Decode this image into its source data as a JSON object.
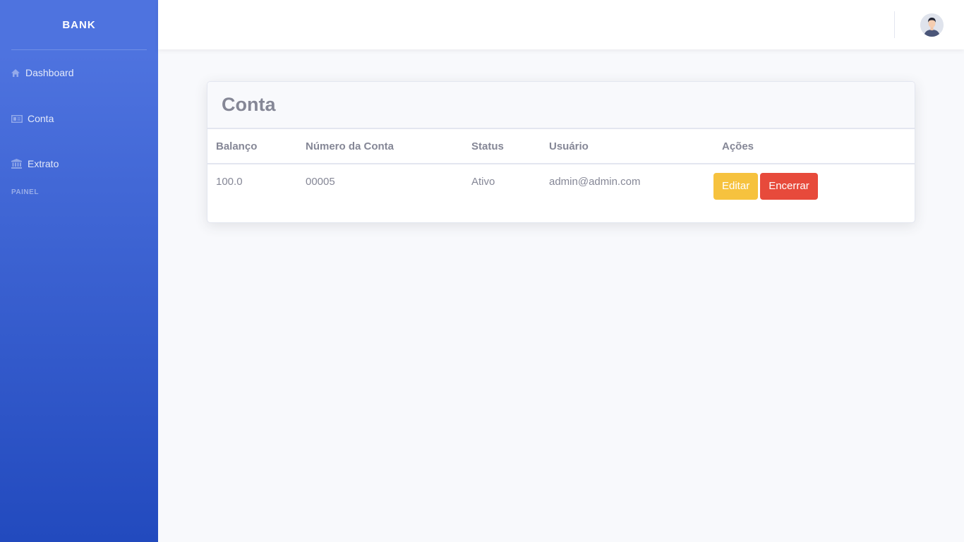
{
  "sidebar": {
    "brand": "BANK",
    "items": [
      {
        "label": "Dashboard",
        "icon": "home-icon"
      },
      {
        "label": "Conta",
        "icon": "id-card-icon"
      },
      {
        "label": "Extrato",
        "icon": "bank-icon"
      }
    ],
    "heading": "PAINEL"
  },
  "topbar": {
    "avatar": "user-avatar-icon"
  },
  "card": {
    "title": "Conta",
    "columns": [
      "Balanço",
      "Número da Conta",
      "Status",
      "Usuário",
      "Ações"
    ],
    "rows": [
      {
        "balance": "100.0",
        "account_number": "00005",
        "status": "Ativo",
        "user": "admin@admin.com",
        "actions": {
          "edit": "Editar",
          "close": "Encerrar"
        }
      }
    ]
  },
  "colors": {
    "sidebar_start": "#4e73df",
    "sidebar_end": "#224abe",
    "warning": "#f6c23e",
    "danger": "#e74a3b",
    "text": "#858796"
  }
}
